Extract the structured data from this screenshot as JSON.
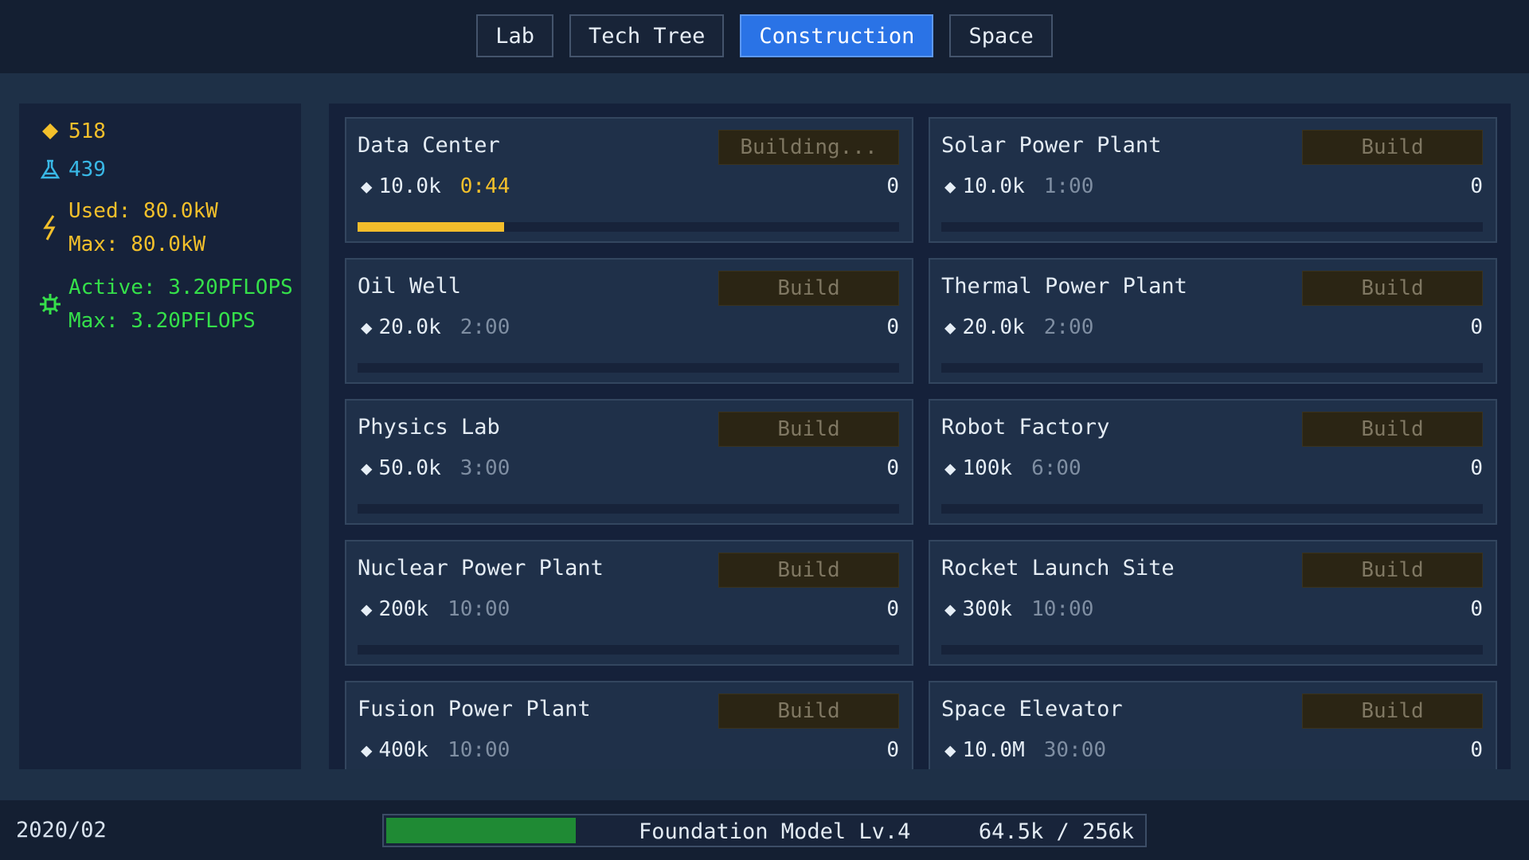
{
  "tabs": [
    {
      "label": "Lab",
      "active": false
    },
    {
      "label": "Tech Tree",
      "active": false
    },
    {
      "label": "Construction",
      "active": true
    },
    {
      "label": "Space",
      "active": false
    }
  ],
  "stats": {
    "gold": "518",
    "science": "439",
    "power_used": "Used: 80.0kW",
    "power_max": "Max: 80.0kW",
    "compute_active": "Active: 3.20PFLOPS",
    "compute_max": "Max: 3.20PFLOPS"
  },
  "buildings": [
    {
      "name": "Data Center",
      "button": "Building...",
      "cost": "10.0k",
      "time": "0:44",
      "count": "0",
      "building": true,
      "progress": 0.27
    },
    {
      "name": "Solar Power Plant",
      "button": "Build",
      "cost": "10.0k",
      "time": "1:00",
      "count": "0",
      "building": false,
      "progress": 0
    },
    {
      "name": "Oil Well",
      "button": "Build",
      "cost": "20.0k",
      "time": "2:00",
      "count": "0",
      "building": false,
      "progress": 0
    },
    {
      "name": "Thermal Power Plant",
      "button": "Build",
      "cost": "20.0k",
      "time": "2:00",
      "count": "0",
      "building": false,
      "progress": 0
    },
    {
      "name": "Physics Lab",
      "button": "Build",
      "cost": "50.0k",
      "time": "3:00",
      "count": "0",
      "building": false,
      "progress": 0
    },
    {
      "name": "Robot Factory",
      "button": "Build",
      "cost": "100k",
      "time": "6:00",
      "count": "0",
      "building": false,
      "progress": 0
    },
    {
      "name": "Nuclear Power Plant",
      "button": "Build",
      "cost": "200k",
      "time": "10:00",
      "count": "0",
      "building": false,
      "progress": 0
    },
    {
      "name": "Rocket Launch Site",
      "button": "Build",
      "cost": "300k",
      "time": "10:00",
      "count": "0",
      "building": false,
      "progress": 0
    },
    {
      "name": "Fusion Power Plant",
      "button": "Build",
      "cost": "400k",
      "time": "10:00",
      "count": "0",
      "building": false,
      "progress": 0
    },
    {
      "name": "Space Elevator",
      "button": "Build",
      "cost": "10.0M",
      "time": "30:00",
      "count": "0",
      "building": false,
      "progress": 0
    }
  ],
  "footer": {
    "date": "2020/02",
    "model_name": "Foundation Model Lv.4",
    "model_progress_text": "64.5k / 256k",
    "model_progress": 0.252
  },
  "colors": {
    "accent": "#2a73e6",
    "gold": "#f3c02b",
    "science": "#39b8e6",
    "compute": "#35e04a",
    "model_bar": "#1f8a34"
  }
}
